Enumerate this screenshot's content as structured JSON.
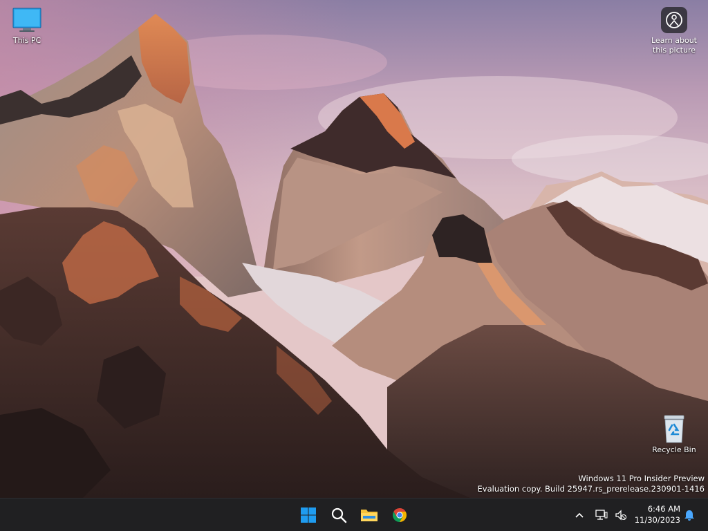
{
  "desktop": {
    "icons": [
      {
        "label": "This PC",
        "icon": "monitor-icon"
      },
      {
        "label": "Recycle Bin",
        "icon": "recycle-bin-icon"
      }
    ],
    "learn_about": {
      "line1": "Learn about",
      "line2": "this picture",
      "icon": "camera-spotlight-icon"
    },
    "watermark": {
      "line1": "Windows 11 Pro Insider Preview",
      "line2": "Evaluation copy. Build 25947.rs_prerelease.230901-1416"
    }
  },
  "taskbar": {
    "apps": [
      {
        "name": "Start",
        "icon": "windows-logo-icon"
      },
      {
        "name": "Search",
        "icon": "search-icon"
      },
      {
        "name": "File Explorer",
        "icon": "folder-icon"
      },
      {
        "name": "Google Chrome",
        "icon": "chrome-icon"
      }
    ],
    "tray": {
      "chevron_icon": "chevron-up-icon",
      "network_icon": "network-icon",
      "volume_icon": "volume-muted-icon",
      "time": "6:46 AM",
      "date": "11/30/2023",
      "notification_icon": "bell-icon"
    }
  },
  "colors": {
    "taskbar_bg": "#202022",
    "accent_blue": "#0078d4",
    "sky_top": "#8d7fa5",
    "rock_highlight": "#d0764a"
  }
}
